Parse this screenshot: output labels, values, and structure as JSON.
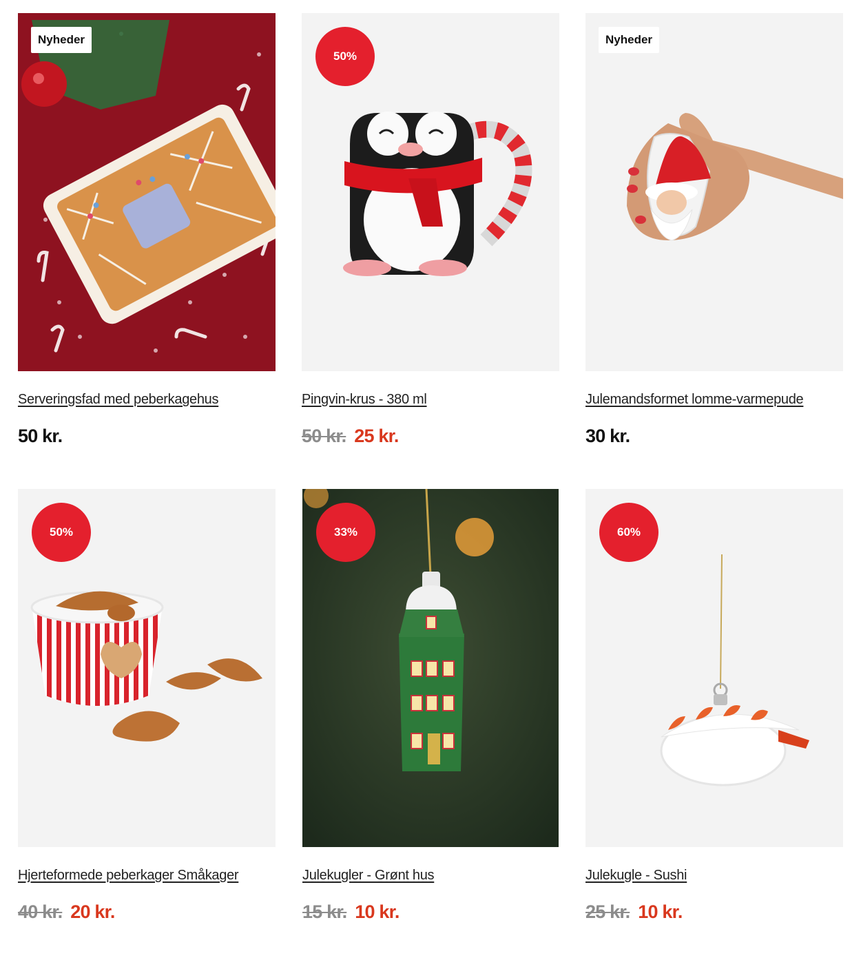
{
  "products": [
    {
      "title": "Serveringsfad med peberkagehus",
      "badge": "Nyheder",
      "price": "50 kr."
    },
    {
      "title": "Pingvin-krus - 380 ml",
      "badge": "50%",
      "old_price": "50 kr.",
      "price": "25 kr."
    },
    {
      "title": "Julemandsformet lomme-varmepude",
      "badge": "Nyheder",
      "price": "30 kr."
    },
    {
      "title": "Hjerteformede peberkager Småkager",
      "badge": "50%",
      "old_price": "40 kr.",
      "price": "20 kr."
    },
    {
      "title": "Julekugler - Grønt hus",
      "badge": "33%",
      "old_price": "15 kr.",
      "price": "10 kr."
    },
    {
      "title": "Julekugle - Sushi",
      "badge": "60%",
      "old_price": "25 kr.",
      "price": "10 kr."
    }
  ],
  "colors": {
    "sale_badge": "#e4202d",
    "sale_price": "#d9381e",
    "old_price": "#8c8c8c",
    "image_background": "#f3f3f3"
  }
}
